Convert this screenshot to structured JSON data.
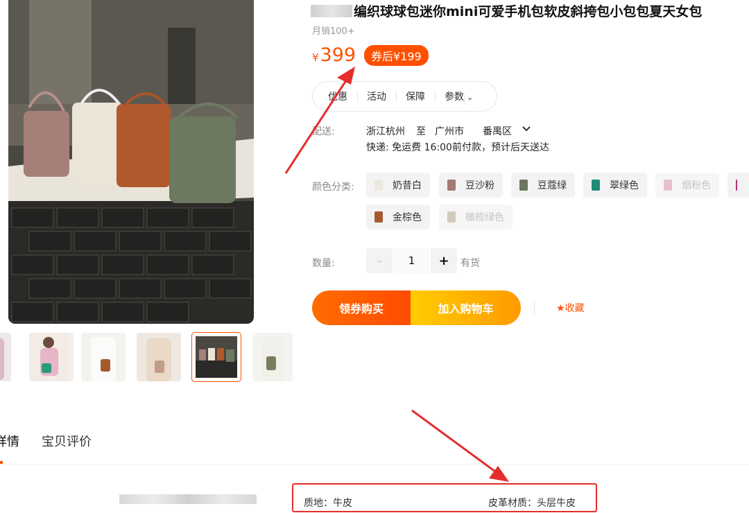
{
  "product": {
    "title": "编织球球包迷你mini可爱手机包软皮斜挎包小包包夏天女包",
    "sales": "月销100+",
    "price_symbol": "¥",
    "price": "399",
    "coupon_price": "券后¥199"
  },
  "info_tabs": [
    "优惠",
    "活动",
    "保障",
    "参数"
  ],
  "shipping": {
    "label": "配送:",
    "from": "浙江杭州",
    "to_word": "至",
    "city": "广州市",
    "district": "番禺区",
    "detail": "快递: 免运费  16:00前付款，预计后天送达"
  },
  "colors": {
    "label": "颜色分类:",
    "options": [
      {
        "name": "奶昔白",
        "color": "#ece8e0",
        "disabled": false
      },
      {
        "name": "豆沙粉",
        "color": "#a27a72",
        "disabled": false
      },
      {
        "name": "豆蔻绿",
        "color": "#6b7560",
        "disabled": false
      },
      {
        "name": "翠绿色",
        "color": "#1f8a76",
        "disabled": false
      },
      {
        "name": "烟粉色",
        "color": "#e6bfcf",
        "disabled": true
      },
      {
        "name": "金棕色",
        "color": "#a45a2e",
        "disabled": false
      },
      {
        "name": "橄榄绿色",
        "color": "#cfcabb",
        "disabled": true
      }
    ]
  },
  "quantity": {
    "label": "数量:",
    "minus": "-",
    "value": "1",
    "plus": "+",
    "stock": "有货"
  },
  "actions": {
    "buy_coupon": "领券购买",
    "add_cart": "加入购物车",
    "favorite": "收藏"
  },
  "detail_tabs": [
    "详情",
    "宝贝评价"
  ],
  "attributes": [
    {
      "text": "质地：牛皮"
    },
    {
      "text": "皮革材质：头层牛皮"
    }
  ],
  "accent_color": "#ff5000",
  "icons": [
    "chevron-down-icon",
    "star-icon",
    "arrow-annotation"
  ]
}
